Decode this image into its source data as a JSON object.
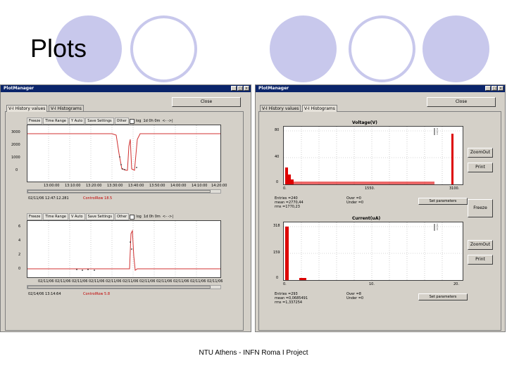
{
  "slide": {
    "title": "Plots",
    "footer": "NTU Athens - INFN Roma I Project"
  },
  "colors": {
    "circle": "#c8c8ec",
    "titlebar": "#0a246a",
    "plotline": "#d03030",
    "histbar": "#dd0000"
  },
  "left_window": {
    "title": "PlotManager",
    "title_buttons": [
      "_",
      "□",
      "×"
    ],
    "close_label": "Close",
    "tabs": [
      "V-I History values",
      "V-I Histograms"
    ],
    "toolbar1": {
      "buttons": [
        "Freeze",
        "Time Range",
        "Y Auto",
        "Save Settings",
        "Other"
      ],
      "log": "log",
      "extra": "1d  0h  0m",
      "arrows": "<-  ->|"
    },
    "plot1": {
      "y_ticks": [
        "3000",
        "2000",
        "1000",
        "0"
      ],
      "x_ticks": [
        "13:00:00",
        "13:10:00",
        "13:20:00",
        "13:30:00",
        "13:40:00",
        "13:50:00",
        "14:00:00",
        "14:10:00",
        "14:20:00"
      ],
      "status_date": "02/11/06 12:47:12.281",
      "status_channel": "ControlRow 18.5"
    },
    "toolbar2": {
      "buttons": [
        "Freeze",
        "Time Range",
        "V Auto",
        "Save Settings",
        "Other"
      ],
      "log": "log",
      "extra": "1d  0h  0m",
      "arrows": "<-  ->|"
    },
    "plot2": {
      "y_ticks": [
        "6",
        "4",
        "2",
        "0"
      ],
      "x_ticks": [
        "02/11/06",
        "02/11/06",
        "02/11/06",
        "02/11/06",
        "02/11/06",
        "02/11/06",
        "02/11/06",
        "02/11/06",
        "02/11/06",
        "02/11/06",
        "02/11/06"
      ],
      "status_date": "02/14/06 13:14:64",
      "status_channel": "ControlRow 5.8"
    }
  },
  "right_window": {
    "title": "PlotManager",
    "title_buttons": [
      "_",
      "□",
      "×"
    ],
    "close_label": "Close",
    "tabs": [
      "V-I History values",
      "V-I Histograms"
    ],
    "hist_voltage": {
      "title": "Voltage(V)",
      "y_ticks": [
        "80",
        "40",
        "0"
      ],
      "x_ticks": [
        "0.",
        "1550.",
        "3100."
      ],
      "stats": [
        "Entries =240",
        "mean =2770,44",
        "rms =1770,23"
      ],
      "over": "Over =0",
      "under": "Under =0",
      "set_params": "Set parameters",
      "zoom_label": "ZoomOut",
      "print_label": "Print"
    },
    "freeze_label": "Freeze",
    "hist_current": {
      "title": "Current(uA)",
      "y_ticks": [
        "318",
        "159",
        "0"
      ],
      "x_ticks": [
        "0.",
        "10.",
        "20."
      ],
      "stats": [
        "Entries =293",
        "mean =0,0685491",
        "rms =1,337254"
      ],
      "over": "Over =8",
      "under": "Under =0",
      "set_params": "Set parameters",
      "zoom_label": "ZoomOut",
      "print_label": "Print"
    }
  }
}
